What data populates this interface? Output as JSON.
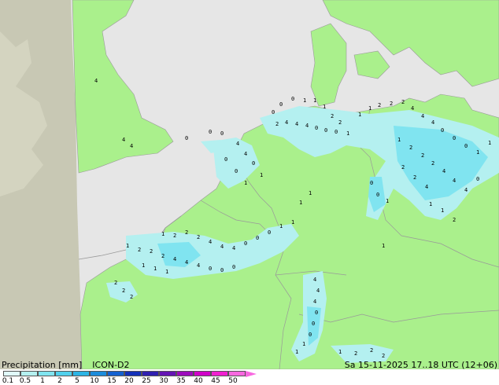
{
  "title": {
    "variable": "Precipitation [mm]",
    "model": "ICON-D2",
    "valid_time": "Sa 15-11-2025 17..18 UTC (12+06)"
  },
  "colorbar": {
    "ticks": [
      "0.1",
      "0.5",
      "1",
      "2",
      "5",
      "10",
      "15",
      "20",
      "25",
      "30",
      "35",
      "40",
      "45",
      "50"
    ],
    "colors": [
      "#e0fafa",
      "#b4f0f0",
      "#80e4f0",
      "#50d0ec",
      "#2cb4e4",
      "#1c8cdc",
      "#1460d0",
      "#1430b8",
      "#3020b0",
      "#6414b4",
      "#9c0cbc",
      "#d000c8",
      "#f020d0",
      "#f868e0"
    ]
  },
  "colors": {
    "sea": "#e6e6e6",
    "land_in_domain": "#aaf08c",
    "outside_domain": "#c8c8b4",
    "border": "#999999",
    "precip_light": "#b4f0f0",
    "precip_medium": "#80e4f0"
  },
  "map_labels": {
    "values": [
      "0",
      "1",
      "2",
      "4"
    ]
  }
}
